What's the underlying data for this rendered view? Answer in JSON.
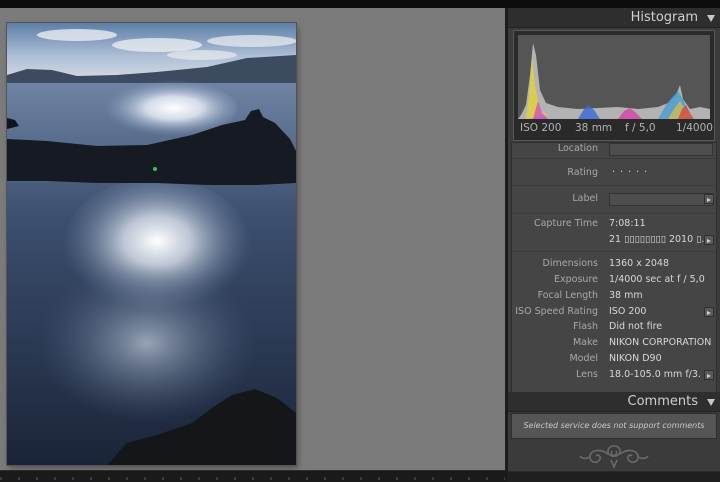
{
  "histogram": {
    "title": "Histogram",
    "info": {
      "iso": "ISO 200",
      "focal": "38 mm",
      "aperture": "f / 5,0",
      "shutter": "1/4000"
    }
  },
  "metadata": {
    "rows": {
      "location": {
        "label": "Location"
      },
      "rating": {
        "label": "Rating",
        "value": "· · · · ·"
      },
      "label_field": {
        "label": "Label"
      },
      "capture_time": {
        "label": "Capture Time",
        "value": "7:08:11",
        "value2": "21 ▯▯▯▯▯▯▯▯ 2010 ▯."
      },
      "dimensions": {
        "label": "Dimensions",
        "value": "1360 x 2048"
      },
      "exposure": {
        "label": "Exposure",
        "value": "1/4000 sec at f / 5,0"
      },
      "focal_length": {
        "label": "Focal Length",
        "value": "38 mm"
      },
      "iso_rating": {
        "label": "ISO Speed Rating",
        "value": "ISO 200"
      },
      "flash": {
        "label": "Flash",
        "value": "Did not fire"
      },
      "make": {
        "label": "Make",
        "value": "NIKON CORPORATION"
      },
      "model": {
        "label": "Model",
        "value": "NIKON D90"
      },
      "lens": {
        "label": "Lens",
        "value": "18.0-105.0 mm f/3."
      }
    }
  },
  "comments": {
    "title": "Comments",
    "message": "Selected service does not support comments"
  },
  "colors": {
    "panel_bg": "#3b3b3b",
    "canvas_bg": "#7b7b7b",
    "text_value": "#d8d8d8"
  }
}
